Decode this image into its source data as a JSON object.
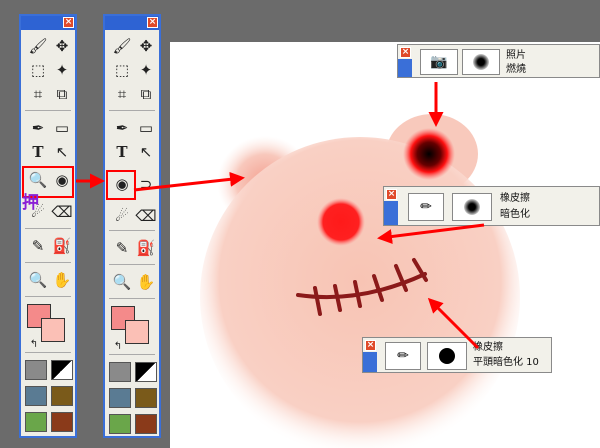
{
  "left_toolbox": {
    "close_glyph": "×",
    "highlight_label": "押",
    "tools": [
      "brush-icon",
      "move-icon",
      "marquee-icon",
      "magic-wand-icon",
      "crop-icon",
      "slice-icon",
      "pen-icon",
      "rectangle-icon",
      "text-icon",
      "pointer-icon",
      "magnifier-icon",
      "eraser-icon",
      "eyedropper-icon",
      "paint-bucket-icon",
      "zoom-icon",
      "hand-icon"
    ]
  },
  "right_toolbox": {
    "close_glyph": "×"
  },
  "panel_photo": {
    "close_glyph": "×",
    "line1": "照片",
    "line2": "燃燒"
  },
  "panel_eraser_darken": {
    "close_glyph": "×",
    "line1": "橡皮擦",
    "line2": "暗色化"
  },
  "panel_eraser_flat": {
    "close_glyph": "×",
    "line1": "橡皮擦",
    "line2": "平頭暗色化 10"
  },
  "colors": {
    "highlight": "#ff0000",
    "bear_pink": "#f6c0b0",
    "eye_red": "#ff1a1a",
    "toolbox_blue": "#2e63d3"
  }
}
